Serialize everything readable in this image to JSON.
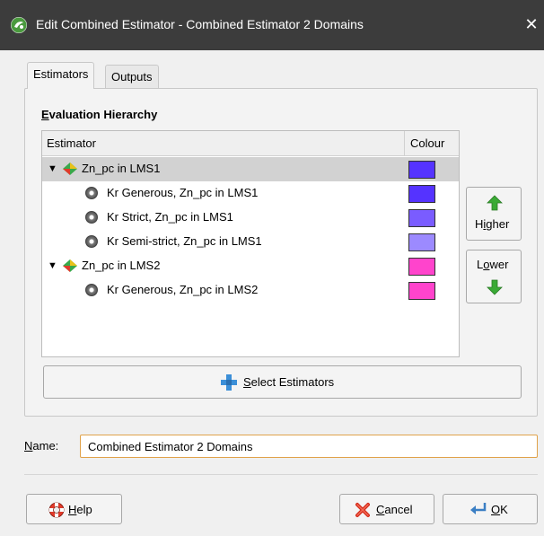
{
  "window": {
    "title": "Edit Combined Estimator - Combined Estimator 2 Domains",
    "close_symbol": "✕"
  },
  "tabs": [
    {
      "label": "Estimators",
      "active": true
    },
    {
      "label": "Outputs",
      "active": false
    }
  ],
  "hierarchy": {
    "title_first": "E",
    "title_rest": "valuation Hierarchy",
    "columns": {
      "estimator": "Estimator",
      "colour": "Colour"
    },
    "rows": [
      {
        "label": "Zn_pc in LMS1",
        "type": "group",
        "expanded": true,
        "selected": true,
        "colour": "#5533ff",
        "expand_symbol": "▼"
      },
      {
        "label": "Kr Generous, Zn_pc in LMS1",
        "type": "kriging",
        "colour": "#5533ff"
      },
      {
        "label": "Kr Strict, Zn_pc in LMS1",
        "type": "kriging",
        "colour": "#7a5cff"
      },
      {
        "label": "Kr Semi-strict, Zn_pc in LMS1",
        "type": "kriging",
        "colour": "#9c8aff"
      },
      {
        "label": "Zn_pc in LMS2",
        "type": "group",
        "expanded": true,
        "selected": false,
        "colour": "#ff44cc",
        "expand_symbol": "▼"
      },
      {
        "label": "Kr Generous, Zn_pc in LMS2",
        "type": "kriging",
        "colour": "#ff44cc"
      }
    ]
  },
  "buttons": {
    "higher": {
      "first": "H",
      "underlined": "i",
      "rest": "gher"
    },
    "lower": {
      "first": "L",
      "underlined": "o",
      "rest": "wer"
    },
    "select_estimators": {
      "underlined": "S",
      "rest": "elect Estimators"
    },
    "help": {
      "underlined": "H",
      "rest": "elp"
    },
    "cancel": {
      "underlined": "C",
      "rest": "ancel"
    },
    "ok": {
      "underlined": "O",
      "rest": "K"
    }
  },
  "name_field": {
    "label_underlined": "N",
    "label_rest": "ame:",
    "value": "Combined Estimator 2 Domains"
  },
  "colors": {
    "titlebar": "#3c3c3c",
    "arrow_green": "#3aaa35",
    "plus_blue": "#3b8fd8"
  },
  "icons": {
    "app": "leapfrog-app-icon",
    "close": "close-icon",
    "estimator_group": "combined-estimator-icon",
    "kriging": "kriging-estimator-icon",
    "higher": "green-up-arrow-icon",
    "lower": "green-down-arrow-icon",
    "select": "blue-plus-icon",
    "help": "lifebuoy-icon",
    "cancel": "red-x-icon",
    "ok": "enter-arrow-icon"
  }
}
